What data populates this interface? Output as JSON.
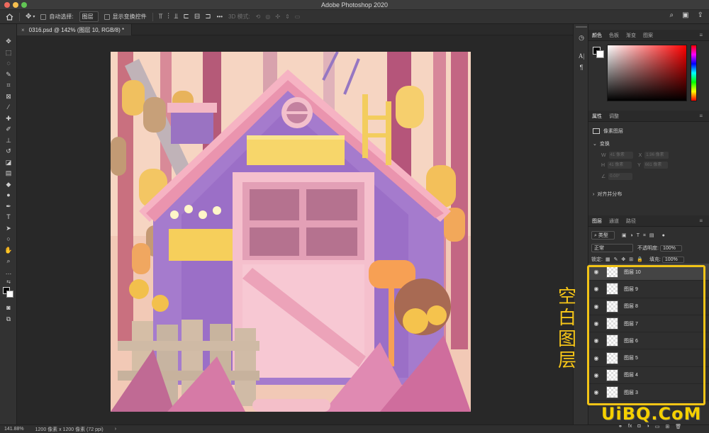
{
  "app": {
    "title": "Adobe Photoshop 2020"
  },
  "options_bar": {
    "auto_select_label": "自动选择:",
    "auto_select_value": "图层",
    "show_transform_label": "显示变换控件",
    "mode_3d_label": "3D 模式:",
    "more_label": "•••"
  },
  "document": {
    "tab_label": "0316.psd @ 142% (图层 10, RGB/8) *",
    "close_glyph": "×"
  },
  "status_bar": {
    "zoom": "141.88%",
    "doc_info": "1200 像素 x 1200 像素 (72 ppi)",
    "arrow": "›"
  },
  "color_panel": {
    "tabs": [
      "颜色",
      "色板",
      "渐变",
      "图案"
    ],
    "active_tab": 0
  },
  "properties_panel": {
    "tabs": [
      "属性",
      "调整"
    ],
    "active_tab": 0,
    "type_label": "像素图层",
    "transform_label": "变换",
    "w_label": "W",
    "w_value": "41 像素",
    "x_label": "X",
    "x_value": "1.96 像素",
    "h_label": "H",
    "h_value": "41 像素",
    "y_label": "Y",
    "y_value": "661 像素",
    "angle_value": "0.00°",
    "align_label": "对齐并分布"
  },
  "layers_panel": {
    "tabs": [
      "图层",
      "通道",
      "路径"
    ],
    "active_tab": 0,
    "filter_label": "类型",
    "blend_mode": "正常",
    "opacity_label": "不透明度:",
    "opacity_value": "100%",
    "lock_label": "锁定:",
    "fill_label": "填充:",
    "fill_value": "100%",
    "eye_glyph": "◉",
    "layers": [
      {
        "name": "图层 10",
        "selected": true
      },
      {
        "name": "图层 9",
        "selected": false
      },
      {
        "name": "图层 8",
        "selected": false
      },
      {
        "name": "图层 7",
        "selected": false
      },
      {
        "name": "图层 6",
        "selected": false
      },
      {
        "name": "图层 5",
        "selected": false
      },
      {
        "name": "图层 4",
        "selected": false
      },
      {
        "name": "图层 3",
        "selected": false
      }
    ]
  },
  "annotation": {
    "line1": "空",
    "line2": "白",
    "line3": "图",
    "line4": "层"
  },
  "watermark": {
    "text": "UiBQ.CoM"
  },
  "colors": {
    "highlight": "#f2c417",
    "annotation": "#f5c518",
    "panel_bg": "#2f2f2f",
    "canvas_bg": "#282828"
  },
  "icons": {
    "home": "home-icon",
    "move": "move-icon",
    "search": "search-icon",
    "eye": "eye-icon"
  }
}
